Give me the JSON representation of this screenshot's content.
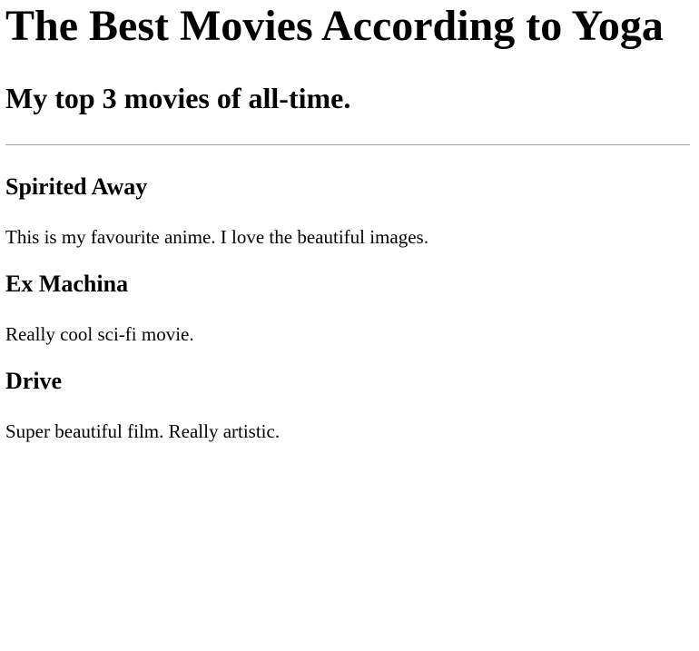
{
  "page": {
    "title": "The Best Movies According to Yoga",
    "subtitle": "My top 3 movies of all-time."
  },
  "movies": [
    {
      "name": "Spirited Away",
      "description": "This is my favourite anime. I love the beautiful images."
    },
    {
      "name": "Ex Machina",
      "description": "Really cool sci-fi movie."
    },
    {
      "name": "Drive",
      "description": "Super beautiful film. Really artistic."
    }
  ]
}
